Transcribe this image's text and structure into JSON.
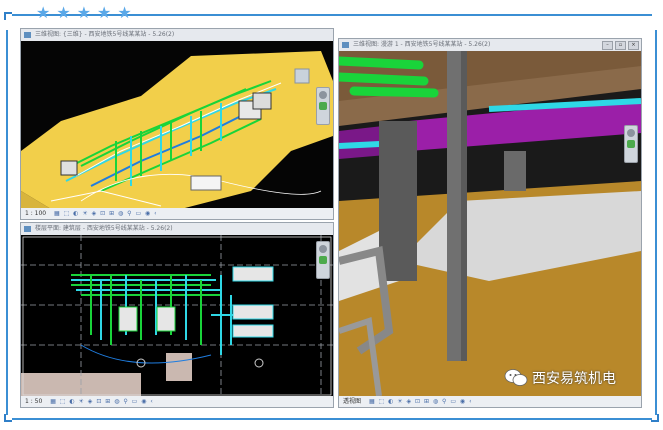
{
  "decor": {
    "star_count": 5,
    "star_color": "#5aa8e8",
    "frame_color": "#3b8fd4"
  },
  "panes": {
    "top_left": {
      "title": "三维视图: {三维} - 西安地铁5号线某某站 - 5.26(2)",
      "scale": "1 : 100",
      "tools": "▦ ⬚ ◐ ☀ ◈ ⊡ ⊞ ◍ ⚲ ▭ ◉ ‹"
    },
    "bottom_left": {
      "title": "楼层平面: 建筑层 - 西安地铁5号线某某站 - 5.26(2)",
      "scale": "1 : 50",
      "tools": "▦ ⬚ ◐ ☀ ◈ ⊡ ⊞ ◍ ⚲ ▭ ◉ ‹"
    },
    "right": {
      "title": "三维视图: 漫游 1 - 西安地铁5号线某某站 - 5.26(2)",
      "scale": "透视图",
      "tools": "▦ ⬚ ◐ ☀ ◈ ⊡ ⊞ ◍ ⚲ ▭ ◉ ‹"
    }
  },
  "window_buttons": {
    "min": "–",
    "max": "▫",
    "close": "×"
  },
  "watermark": {
    "text": "西安易筑机电",
    "icon": "wechat-icon"
  },
  "colors": {
    "pipe_green": "#19d43a",
    "pipe_cyan": "#2fd8e6",
    "duct_purple": "#9b1fa8",
    "floor_yellow": "#f2cf4a",
    "floor_orange": "#b8882a"
  }
}
